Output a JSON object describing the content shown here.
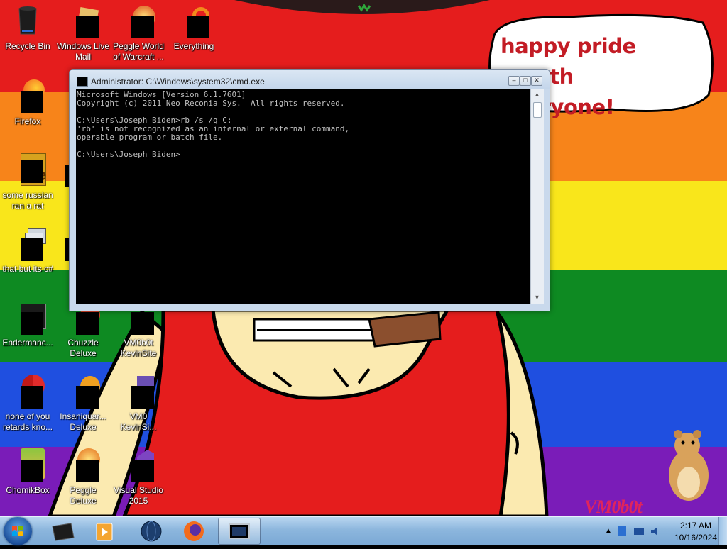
{
  "desktop": {
    "speech_bubble_text": "happy pride month\neveryone!",
    "watermark": "VM0b0t",
    "icons": [
      {
        "label": "Recycle Bin"
      },
      {
        "label": "Windows Live\nMail"
      },
      {
        "label": "Peggle World\nof Warcraft ..."
      },
      {
        "label": "Everything"
      },
      {
        "label": "Firefox"
      },
      {
        "label": "some russian\nran a rat"
      },
      {
        "label": "that but its c#"
      },
      {
        "label": "Endermanc..."
      },
      {
        "label": "Chuzzle\nDeluxe"
      },
      {
        "label": "VM0b0t\nKevinSite"
      },
      {
        "label": "none of you\nretards kno..."
      },
      {
        "label": "Insaniquar...\nDeluxe"
      },
      {
        "label": "VM0\nKevinSi..."
      },
      {
        "label": "ChomikBox"
      },
      {
        "label": "Peggle Deluxe"
      },
      {
        "label": "Visual Studio\n2015"
      }
    ]
  },
  "cmd": {
    "title": "Administrator: C:\\Windows\\system32\\cmd.exe",
    "output": "Microsoft Windows [Version 6.1.7601]\nCopyright (c) 2011 Neo Reconia Sys.  All rights reserved.\n\nC:\\Users\\Joseph Biden>rb /s /q C:\n'rb' is not recognized as an internal or external command,\noperable program or batch file.\n\nC:\\Users\\Joseph Biden>"
  },
  "taskbar": {
    "time": "2:17 AM",
    "date": "10/16/2024"
  },
  "colors": {
    "rainbow": [
      "#e51d1d",
      "#f7841a",
      "#f9e61b",
      "#0e8a22",
      "#1f4fe0",
      "#7a1cb8"
    ],
    "speech_text": "#c31c25"
  }
}
